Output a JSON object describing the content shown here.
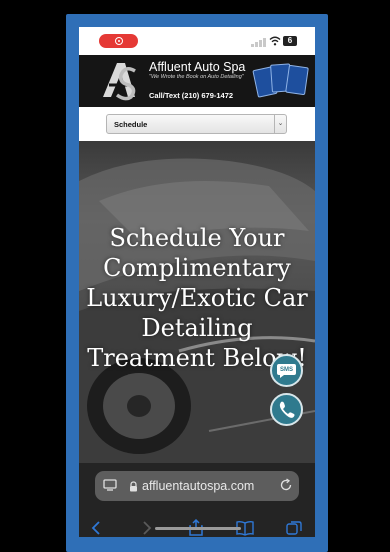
{
  "header": {
    "brand": "Affluent Auto Spa",
    "tagline": "\"We Wrote the Book on Auto Detailing\"",
    "phone": "Call/Text (210) 679-1472"
  },
  "schedule": {
    "select_label": "Schedule"
  },
  "hero": {
    "title": "Schedule Your Complimentary Luxury/Exotic Car Detailing Treatment Below!"
  },
  "floating_buttons": {
    "sms_label": "SMS"
  },
  "browser": {
    "url": "affluentautospa.com"
  },
  "colors": {
    "frame_border": "#2f6fb7",
    "fab_bg": "#2f7a8e",
    "record_pill": "#e53935",
    "toolbar_icon": "#2f78d6"
  }
}
